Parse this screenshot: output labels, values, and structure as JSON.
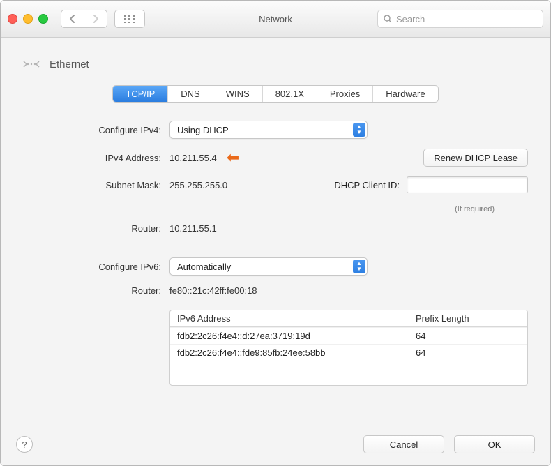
{
  "window": {
    "title": "Network"
  },
  "search": {
    "placeholder": "Search"
  },
  "breadcrumb": {
    "label": "Ethernet"
  },
  "tabs": [
    {
      "label": "TCP/IP",
      "active": true
    },
    {
      "label": "DNS",
      "active": false
    },
    {
      "label": "WINS",
      "active": false
    },
    {
      "label": "802.1X",
      "active": false
    },
    {
      "label": "Proxies",
      "active": false
    },
    {
      "label": "Hardware",
      "active": false
    }
  ],
  "form": {
    "configure_ipv4_label": "Configure IPv4:",
    "configure_ipv4_value": "Using DHCP",
    "ipv4_address_label": "IPv4 Address:",
    "ipv4_address_value": "10.211.55.4",
    "subnet_mask_label": "Subnet Mask:",
    "subnet_mask_value": "255.255.255.0",
    "router_label": "Router:",
    "router_value": "10.211.55.1",
    "renew_button": "Renew DHCP Lease",
    "dhcp_client_id_label": "DHCP Client ID:",
    "dhcp_client_id_value": "",
    "if_required": "(If required)",
    "configure_ipv6_label": "Configure IPv6:",
    "configure_ipv6_value": "Automatically",
    "router6_label": "Router:",
    "router6_value": "fe80::21c:42ff:fe00:18"
  },
  "ipv6_table": {
    "headers": {
      "addr": "IPv6 Address",
      "prefix": "Prefix Length"
    },
    "rows": [
      {
        "addr": "fdb2:2c26:f4e4::d:27ea:3719:19d",
        "prefix": "64"
      },
      {
        "addr": "fdb2:2c26:f4e4::fde9:85fb:24ee:58bb",
        "prefix": "64"
      }
    ]
  },
  "footer": {
    "help": "?",
    "cancel": "Cancel",
    "ok": "OK"
  }
}
